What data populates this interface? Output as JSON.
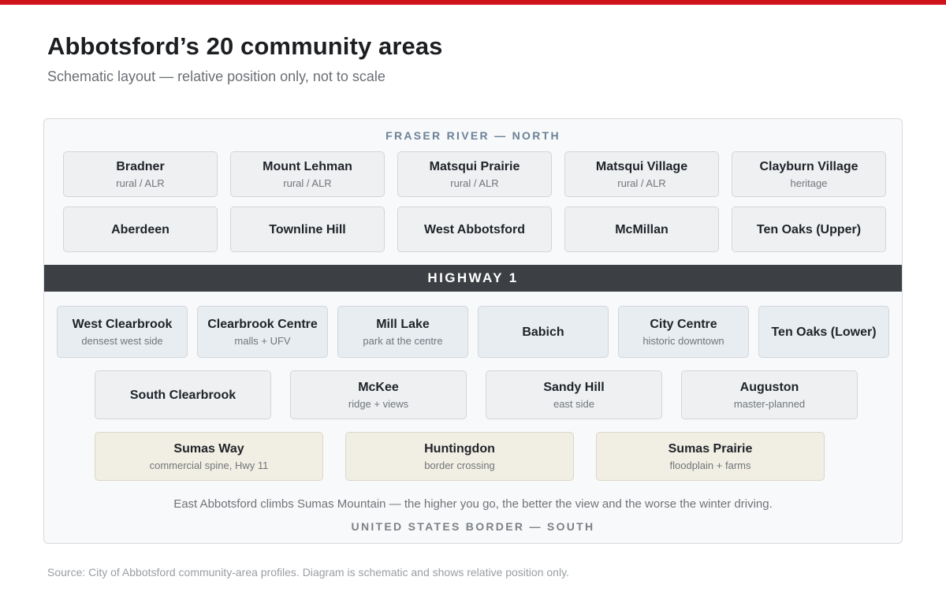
{
  "title": "Abbotsford’s 20 community areas",
  "subtitle": "Schematic layout — relative position only, not to scale",
  "north_label": "FRASER RIVER — NORTH",
  "highway_label": "HIGHWAY 1",
  "south_label": "UNITED STATES BORDER — SOUTH",
  "note": "East Abbotsford climbs Sumas Mountain — the higher you go, the better the view and the worse the winter driving.",
  "source": "Source: City of Abbotsford community-area profiles. Diagram is schematic and shows relative position only.",
  "colors": {
    "accent_bar": "#d0121b",
    "highway": "#3c3f43",
    "north_tile": "#eef0f2",
    "central_tile": "#e8edf1",
    "south_tile": "#f1eee3"
  },
  "rows": [
    {
      "zone": "north",
      "areas": [
        {
          "name": "Bradner",
          "desc": "rural / ALR"
        },
        {
          "name": "Mount Lehman",
          "desc": "rural / ALR"
        },
        {
          "name": "Matsqui Prairie",
          "desc": "rural / ALR"
        },
        {
          "name": "Matsqui Village",
          "desc": "rural / ALR"
        },
        {
          "name": "Clayburn Village",
          "desc": "heritage"
        }
      ]
    },
    {
      "zone": "north",
      "areas": [
        {
          "name": "Aberdeen",
          "desc": ""
        },
        {
          "name": "Townline Hill",
          "desc": ""
        },
        {
          "name": "West Abbotsford",
          "desc": ""
        },
        {
          "name": "McMillan",
          "desc": ""
        },
        {
          "name": "Ten Oaks (Upper)",
          "desc": ""
        }
      ]
    },
    {
      "zone": "central",
      "areas": [
        {
          "name": "West Clearbrook",
          "desc": "densest west side"
        },
        {
          "name": "Clearbrook Centre",
          "desc": "malls + UFV"
        },
        {
          "name": "Mill Lake",
          "desc": "park at the centre"
        },
        {
          "name": "Babich",
          "desc": ""
        },
        {
          "name": "City Centre",
          "desc": "historic downtown"
        },
        {
          "name": "Ten Oaks (Lower)",
          "desc": ""
        }
      ]
    },
    {
      "zone": "central-grey",
      "areas": [
        {
          "name": "South Clearbrook",
          "desc": ""
        },
        {
          "name": "McKee",
          "desc": "ridge + views"
        },
        {
          "name": "Sandy Hill",
          "desc": "east side"
        },
        {
          "name": "Auguston",
          "desc": "master-planned"
        }
      ]
    },
    {
      "zone": "south",
      "areas": [
        {
          "name": "Sumas Way",
          "desc": "commercial spine, Hwy 11"
        },
        {
          "name": "Huntingdon",
          "desc": "border crossing"
        },
        {
          "name": "Sumas Prairie",
          "desc": "floodplain + farms"
        }
      ]
    }
  ]
}
